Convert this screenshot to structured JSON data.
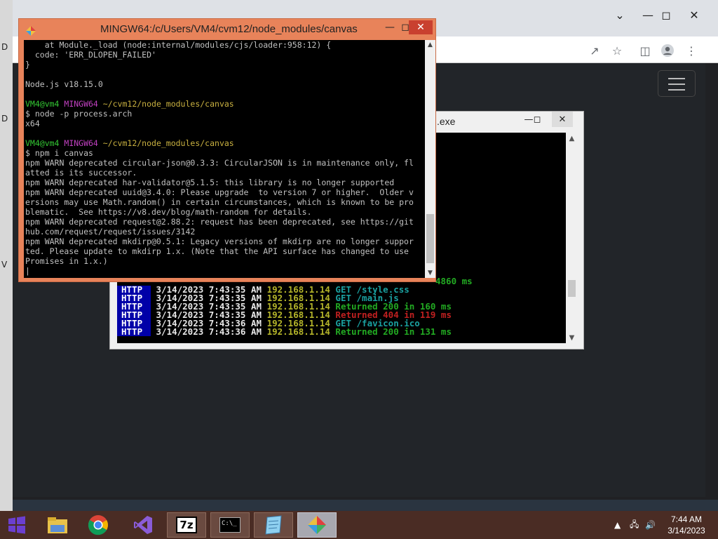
{
  "desktop": {
    "left_strip_glyphs": [
      "D",
      "D",
      "V"
    ]
  },
  "browser": {
    "toolbar_icons": [
      "share-icon",
      "star-icon",
      "sidebar-icon",
      "profile-icon",
      "menu-dots-icon"
    ]
  },
  "back_window": {
    "title": ".exe",
    "lines": [
      {
        "segments": [
          {
            "text": "4860 ms",
            "color": "green"
          }
        ]
      },
      {
        "segments": [
          {
            "text": "HTTP",
            "color": "tag"
          },
          {
            "text": " 3/14/2023 7:43:35 AM ",
            "color": "white"
          },
          {
            "text": "192.168.1.14",
            "color": "yellow"
          },
          {
            "text": " GET /style.css",
            "color": "cyan"
          }
        ]
      },
      {
        "segments": [
          {
            "text": "HTTP",
            "color": "tag"
          },
          {
            "text": " 3/14/2023 7:43:35 AM ",
            "color": "white"
          },
          {
            "text": "192.168.1.14",
            "color": "yellow"
          },
          {
            "text": " GET /main.js",
            "color": "cyan"
          }
        ]
      },
      {
        "segments": [
          {
            "text": "HTTP",
            "color": "tag"
          },
          {
            "text": " 3/14/2023 7:43:35 AM ",
            "color": "white"
          },
          {
            "text": "192.168.1.14",
            "color": "yellow"
          },
          {
            "text": " Returned 200 in 160 ms",
            "color": "green"
          }
        ]
      },
      {
        "segments": [
          {
            "text": "HTTP",
            "color": "tag"
          },
          {
            "text": " 3/14/2023 7:43:35 AM ",
            "color": "white"
          },
          {
            "text": "192.168.1.14",
            "color": "yellow"
          },
          {
            "text": " Returned 404 in 119 ms",
            "color": "red"
          }
        ]
      },
      {
        "segments": [
          {
            "text": "HTTP",
            "color": "tag"
          },
          {
            "text": " 3/14/2023 7:43:36 AM ",
            "color": "white"
          },
          {
            "text": "192.168.1.14",
            "color": "yellow"
          },
          {
            "text": " GET /favicon.ico",
            "color": "cyan"
          }
        ]
      },
      {
        "segments": [
          {
            "text": "HTTP",
            "color": "tag"
          },
          {
            "text": " 3/14/2023 7:43:36 AM ",
            "color": "white"
          },
          {
            "text": "192.168.1.14",
            "color": "yellow"
          },
          {
            "text": " Returned 200 in 131 ms",
            "color": "green"
          }
        ]
      }
    ]
  },
  "mintty": {
    "title": "MINGW64:/c/Users/VM4/cvm12/node_modules/canvas",
    "lines": [
      [
        {
          "t": "    at Module._load (node:internal/modules/cjs/loader:958:12) {",
          "c": "n"
        }
      ],
      [
        {
          "t": "  code: 'ERR_DLOPEN_FAILED'",
          "c": "n"
        }
      ],
      [
        {
          "t": "}",
          "c": "n"
        }
      ],
      [
        {
          "t": "",
          "c": "n"
        }
      ],
      [
        {
          "t": "Node.js v18.15.0",
          "c": "n"
        }
      ],
      [
        {
          "t": "",
          "c": "n"
        }
      ],
      [
        {
          "t": "VM4@vm4 ",
          "c": "g"
        },
        {
          "t": "MINGW64 ",
          "c": "m"
        },
        {
          "t": "~/cvm12/node_modules/canvas",
          "c": "y"
        }
      ],
      [
        {
          "t": "$ node -p process.arch",
          "c": "n"
        }
      ],
      [
        {
          "t": "x64",
          "c": "n"
        }
      ],
      [
        {
          "t": "",
          "c": "n"
        }
      ],
      [
        {
          "t": "VM4@vm4 ",
          "c": "g"
        },
        {
          "t": "MINGW64 ",
          "c": "m"
        },
        {
          "t": "~/cvm12/node_modules/canvas",
          "c": "y"
        }
      ],
      [
        {
          "t": "$ npm i canvas",
          "c": "n"
        }
      ],
      [
        {
          "t": "npm WARN deprecated circular-json@0.3.3: CircularJSON is in maintenance only, fl",
          "c": "n"
        }
      ],
      [
        {
          "t": "atted is its successor.",
          "c": "n"
        }
      ],
      [
        {
          "t": "npm WARN deprecated har-validator@5.1.5: this library is no longer supported",
          "c": "n"
        }
      ],
      [
        {
          "t": "npm WARN deprecated uuid@3.4.0: Please upgrade  to version 7 or higher.  Older v",
          "c": "n"
        }
      ],
      [
        {
          "t": "ersions may use Math.random() in certain circumstances, which is known to be pro",
          "c": "n"
        }
      ],
      [
        {
          "t": "blematic.  See https://v8.dev/blog/math-random for details.",
          "c": "n"
        }
      ],
      [
        {
          "t": "npm WARN deprecated request@2.88.2: request has been deprecated, see https://git",
          "c": "n"
        }
      ],
      [
        {
          "t": "hub.com/request/request/issues/3142",
          "c": "n"
        }
      ],
      [
        {
          "t": "npm WARN deprecated mkdirp@0.5.1: Legacy versions of mkdirp are no longer suppor",
          "c": "n"
        }
      ],
      [
        {
          "t": "ted. Please update to mkdirp 1.x. (Note that the API surface has changed to use",
          "c": "n"
        }
      ],
      [
        {
          "t": "Promises in 1.x.)",
          "c": "n"
        }
      ],
      [
        {
          "t": "|",
          "c": "n"
        }
      ]
    ]
  },
  "taskbar": {
    "apps": [
      {
        "name": "file-explorer",
        "label": ""
      },
      {
        "name": "chrome",
        "label": ""
      },
      {
        "name": "visual-studio",
        "label": ""
      },
      {
        "name": "7zip",
        "label": "7z"
      },
      {
        "name": "command-prompt",
        "label": "C:\\_"
      },
      {
        "name": "notepad",
        "label": ""
      },
      {
        "name": "git-bash",
        "label": ""
      }
    ],
    "clock_time": "7:44 AM",
    "clock_date": "3/14/2023"
  }
}
